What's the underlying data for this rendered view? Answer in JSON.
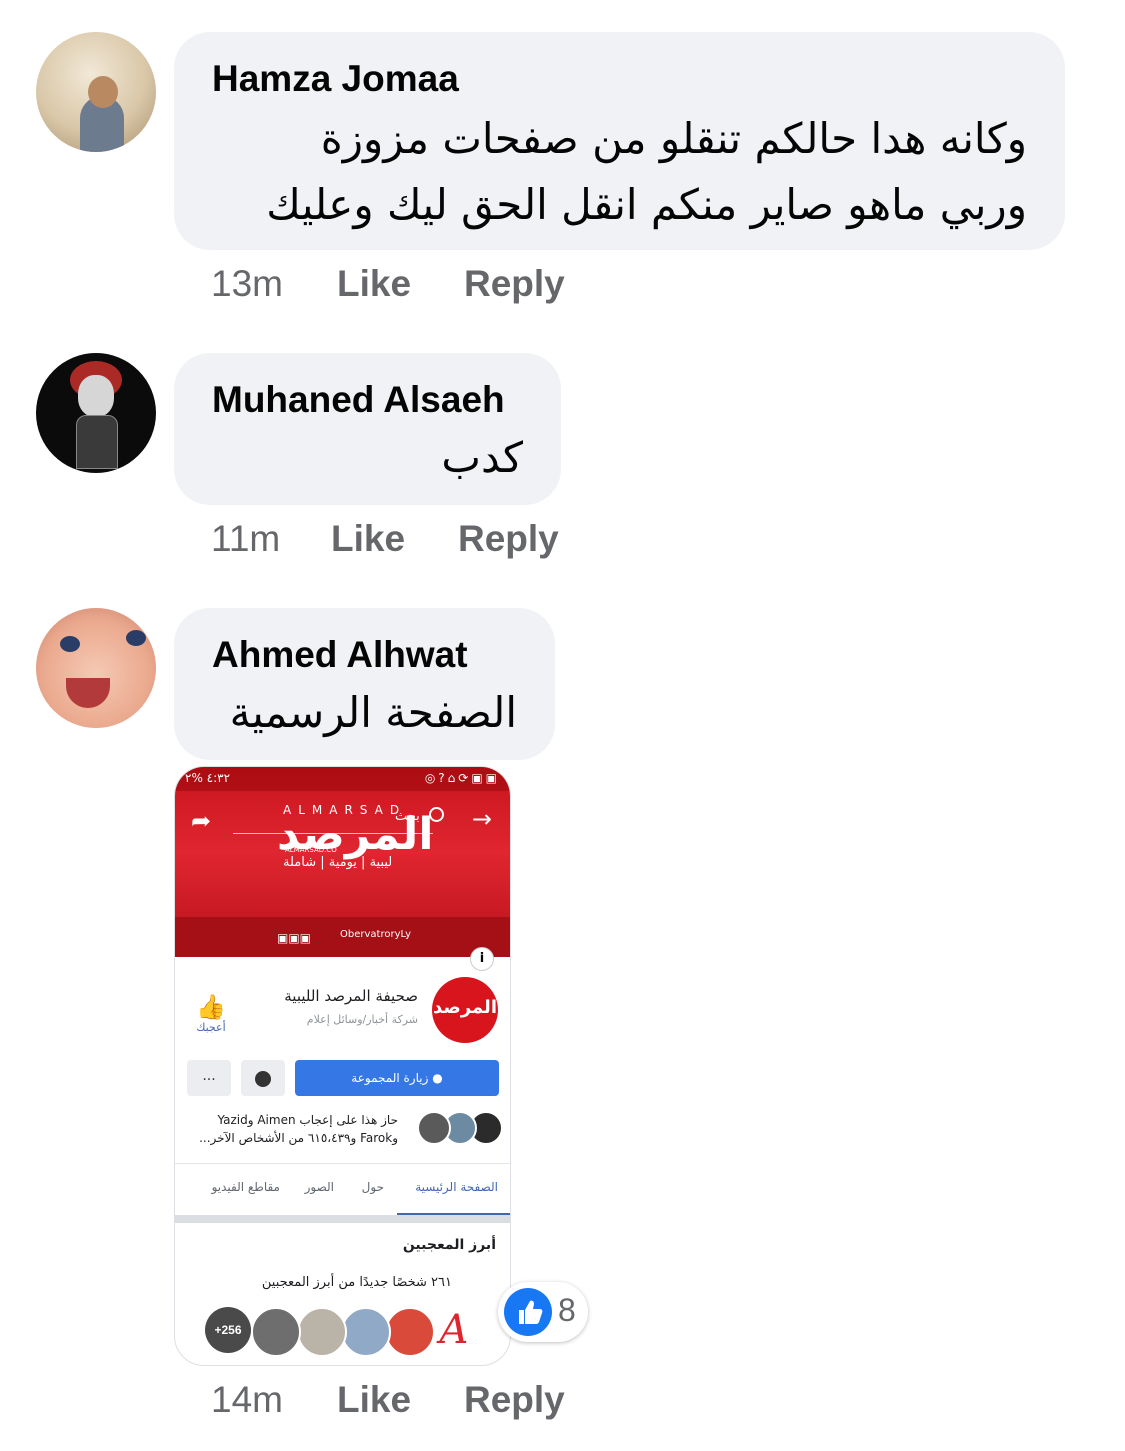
{
  "comments": [
    {
      "author": "Hamza Jomaa",
      "text_lines": [
        "وكانه هدا حالكم تنقلو من صفحات مزوزة",
        "وربي ماهو صاير منكم انقل الحق ليك وعليك"
      ],
      "time": "13m",
      "like_label": "Like",
      "reply_label": "Reply"
    },
    {
      "author": "Muhaned Alsaeh",
      "text_lines": [
        "كدب"
      ],
      "time": "11m",
      "like_label": "Like",
      "reply_label": "Reply"
    },
    {
      "author": "Ahmed Alhwat",
      "text_lines": [
        "الصفحة الرسمية"
      ],
      "time": "14m",
      "like_label": "Like",
      "reply_label": "Reply",
      "reaction": {
        "icon": "thumbs-up-icon",
        "count": "8",
        "color": "#1877f2"
      }
    }
  ],
  "attachment": {
    "status_left": "٤:٣٢ %٢",
    "cover": {
      "brand_en": "ALMARSAD",
      "brand_ar": "المرصد",
      "site": "ALMARSAD.CO",
      "tagline": "ليبية | يومية | شاملة",
      "social": "ObervatroryLy",
      "search_hint": "بحث",
      "color": "#d8141d"
    },
    "page": {
      "logo_text": "المرصد",
      "name": "صحيفة المرصد الليبية",
      "category": "شركة أخبار/وسائل إعلام",
      "like_label": "أعجبك",
      "more_label": "...",
      "visit_label": "زيارة المجموعة",
      "friends_line1": "حاز هذا على إعجاب Aimen وYazid",
      "friends_line2": "وFarok و٦١٥،٤٣٩ من الأشخاص الآخر..."
    },
    "tabs": [
      "الصفحة الرئيسية",
      "حول",
      "الصور",
      "مقاطع الفيديو"
    ],
    "top_fans": {
      "title": "أبرز المعجبين",
      "subtitle": "٢٦١ شخصًا جديدًا من أبرز المعجبين",
      "more_count": "+256"
    }
  }
}
